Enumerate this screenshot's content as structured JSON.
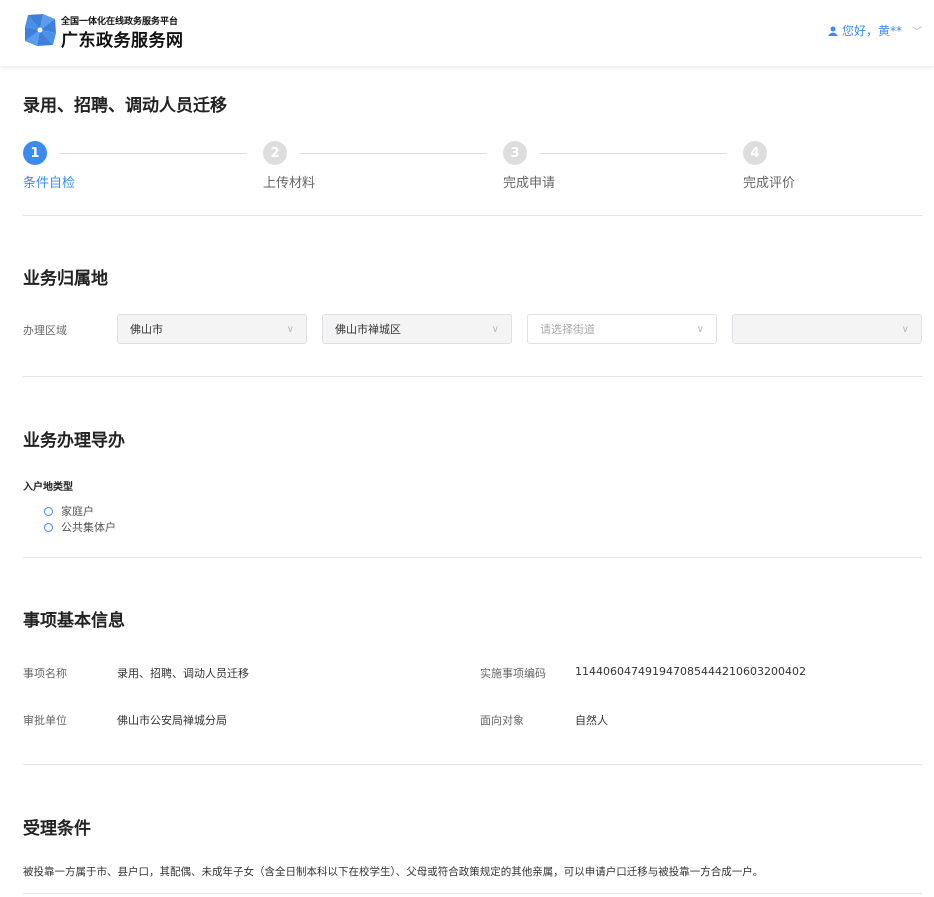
{
  "header": {
    "platform_subtitle": "全国一体化在线政务服务平台",
    "site_name": "广东政务服务网",
    "greeting": "您好，黄**"
  },
  "page_title": "录用、招聘、调动人员迁移",
  "steps": [
    {
      "num": "1",
      "label": "条件自检"
    },
    {
      "num": "2",
      "label": "上传材料"
    },
    {
      "num": "3",
      "label": "完成申请"
    },
    {
      "num": "4",
      "label": "完成评价"
    }
  ],
  "location": {
    "title": "业务归属地",
    "label": "办理区域",
    "city": "佛山市",
    "district": "佛山市禅城区",
    "street_placeholder": "请选择街道",
    "extra": ""
  },
  "guide": {
    "title": "业务办理导办",
    "question": "入户地类型",
    "options": [
      "家庭户",
      "公共集体户"
    ]
  },
  "info": {
    "title": "事项基本信息",
    "name_label": "事项名称",
    "name": "录用、招聘、调动人员迁移",
    "code_label": "实施事项编码",
    "code": "11440604749194708544421060320040​2",
    "unit_label": "审批单位",
    "unit": "佛山市公安局禅城分局",
    "target_label": "面向对象",
    "target": "自然人"
  },
  "conditions": {
    "title": "受理条件",
    "text": "被投靠一方属于市、县户口，其配偶、未成年子女（含全日制本科以下在校学生）、父母或符合政策规定的其他亲属，可以申请户口迁移与被投靠一方合成一户。"
  }
}
